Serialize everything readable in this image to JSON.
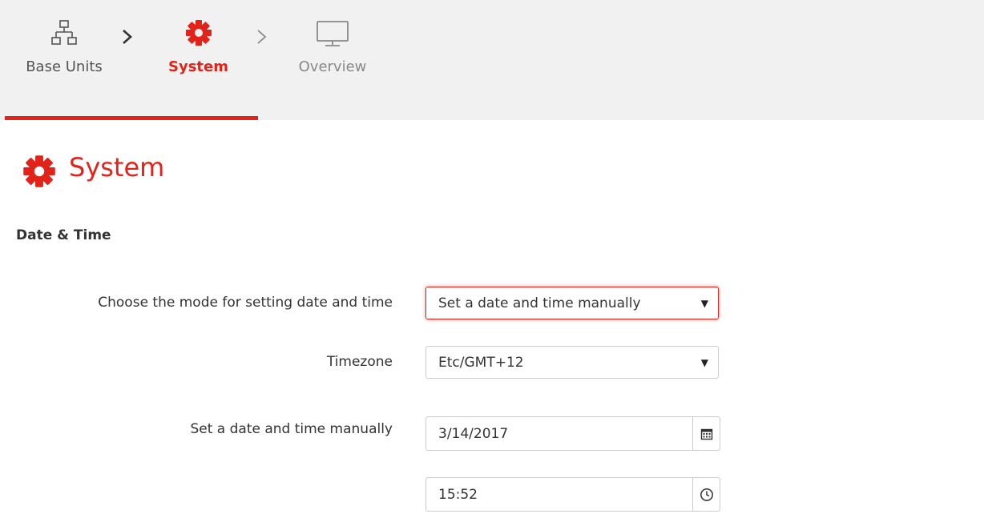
{
  "wizard": {
    "steps": [
      {
        "label": "Base Units",
        "icon": "network-icon",
        "state": "done"
      },
      {
        "label": "System",
        "icon": "gear-icon",
        "state": "active"
      },
      {
        "label": "Overview",
        "icon": "monitor-icon",
        "state": "pending"
      }
    ],
    "separators": [
      "chevron-right-icon",
      "chevron-right-icon"
    ]
  },
  "page": {
    "title": "System",
    "title_icon": "gear-icon"
  },
  "section": {
    "title": "Date & Time"
  },
  "form": {
    "mode": {
      "label": "Choose the mode for setting date and time",
      "value": "Set a date and time manually"
    },
    "timezone": {
      "label": "Timezone",
      "value": "Etc/GMT+12"
    },
    "manual": {
      "label": "Set a date and time manually",
      "date_value": "3/14/2017",
      "time_value": "15:52",
      "date_icon": "calendar-icon",
      "time_icon": "clock-icon"
    }
  },
  "colors": {
    "accent": "#e2231a",
    "wizard_bg": "#f1f1f1",
    "text": "#333333",
    "muted": "#888888"
  }
}
